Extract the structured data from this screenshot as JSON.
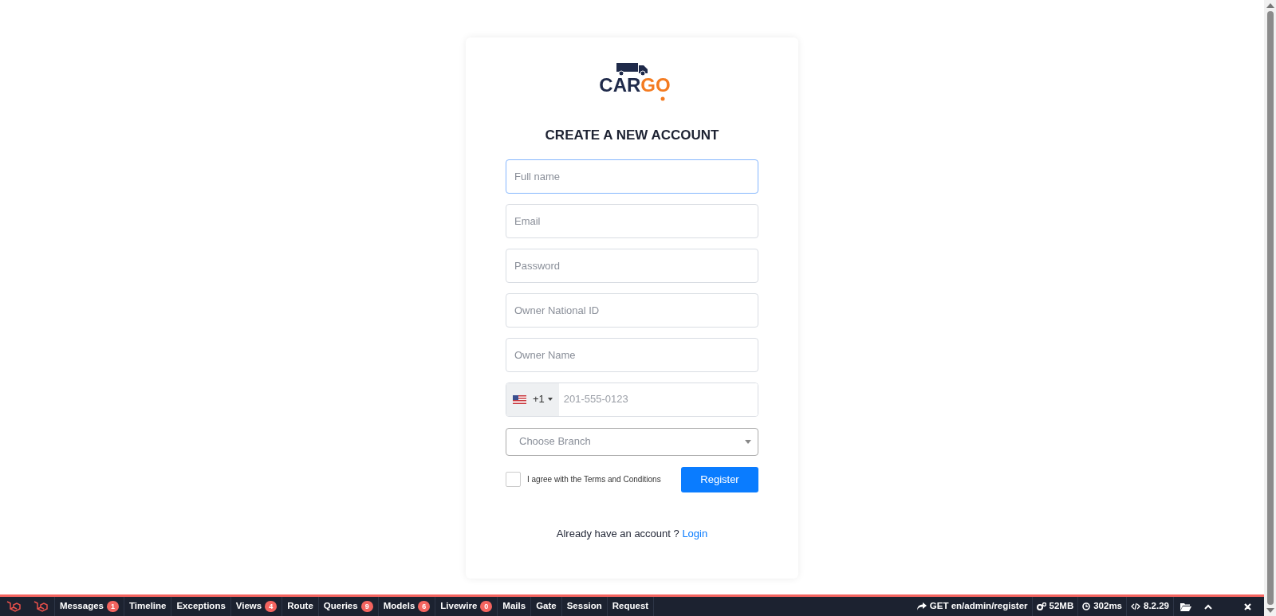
{
  "logo": {
    "dark": "CAR",
    "accent": "GO"
  },
  "heading": "CREATE A NEW ACCOUNT",
  "fields": [
    {
      "placeholder": "Full name",
      "focused": true
    },
    {
      "placeholder": "Email",
      "focused": false
    },
    {
      "placeholder": "Password",
      "focused": false
    },
    {
      "placeholder": "Owner National ID",
      "focused": false
    },
    {
      "placeholder": "Owner Name",
      "focused": false
    }
  ],
  "phone": {
    "dial_code": "+1",
    "placeholder": "201-555-0123"
  },
  "branch_select": {
    "placeholder": "Choose Branch"
  },
  "terms": {
    "label": "I agree with the Terms and Conditions",
    "checked": false
  },
  "register_button": "Register",
  "login_prompt": {
    "text": "Already have an account ?",
    "link": "Login"
  },
  "debugbar": {
    "tabs": [
      {
        "label": "Messages",
        "count": "1"
      },
      {
        "label": "Timeline"
      },
      {
        "label": "Exceptions"
      },
      {
        "label": "Views",
        "count": "4"
      },
      {
        "label": "Route"
      },
      {
        "label": "Queries",
        "count": "9"
      },
      {
        "label": "Models",
        "count": "6"
      },
      {
        "label": "Livewire",
        "count": "0"
      },
      {
        "label": "Mails"
      },
      {
        "label": "Gate"
      },
      {
        "label": "Session"
      },
      {
        "label": "Request"
      }
    ],
    "status": [
      {
        "kind": "request",
        "text": "GET en/admin/register"
      },
      {
        "kind": "memory",
        "text": "52MB"
      },
      {
        "kind": "time",
        "text": "302ms"
      },
      {
        "kind": "version",
        "text": "8.2.29"
      }
    ]
  }
}
